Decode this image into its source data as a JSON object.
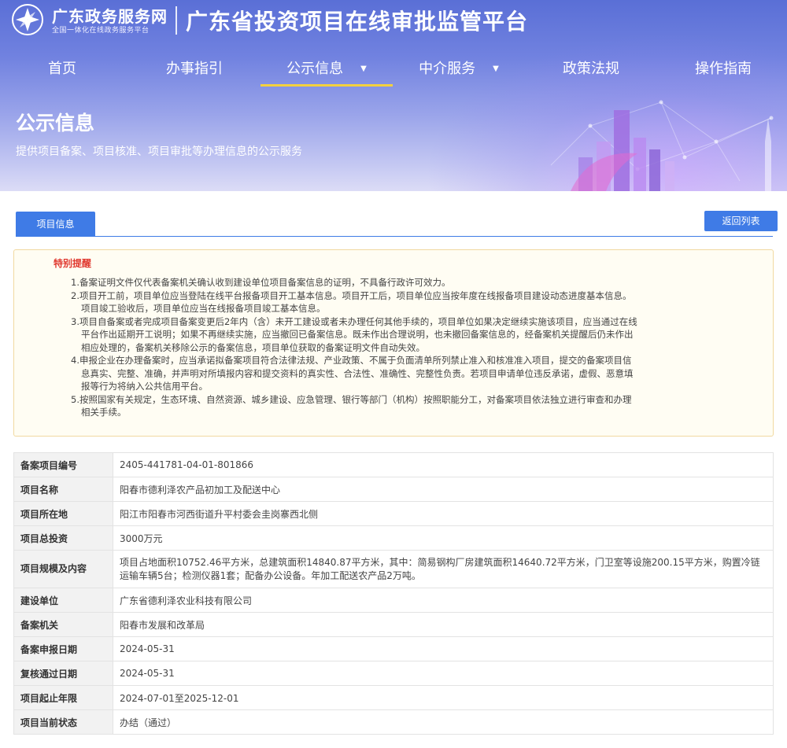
{
  "header": {
    "site_name": "广东政务服务网",
    "site_tagline": "全国一体化在线政务服务平台",
    "platform_title": "广东省投资项目在线审批监管平台"
  },
  "nav": {
    "items": [
      {
        "label": "首页",
        "has_dropdown": false,
        "active": false
      },
      {
        "label": "办事指引",
        "has_dropdown": false,
        "active": false
      },
      {
        "label": "公示信息",
        "has_dropdown": true,
        "active": true
      },
      {
        "label": "中介服务",
        "has_dropdown": true,
        "active": false
      },
      {
        "label": "政策法规",
        "has_dropdown": false,
        "active": false
      },
      {
        "label": "操作指南",
        "has_dropdown": false,
        "active": false
      }
    ]
  },
  "hero": {
    "title": "公示信息",
    "subtitle": "提供项目备案、项目核准、项目审批等办理信息的公示服务"
  },
  "tabs": {
    "active_label": "项目信息",
    "back_label": "返回列表"
  },
  "notice": {
    "title": "特别提醒",
    "lines": [
      {
        "text": "1.备案证明文件仅代表备案机关确认收到建设单位项目备案信息的证明，不具备行政许可效力。",
        "indent": false
      },
      {
        "text": "2.项目开工前，项目单位应当登陆在线平台报备项目开工基本信息。项目开工后，项目单位应当按年度在线报备项目建设动态进度基本信息。",
        "indent": false
      },
      {
        "text": "项目竣工验收后，项目单位应当在线报备项目竣工基本信息。",
        "indent": true
      },
      {
        "text": "3.项目自备案或者完成项目备案变更后2年内（含）未开工建设或者未办理任何其他手续的，项目单位如果决定继续实施该项目，应当通过在线",
        "indent": false
      },
      {
        "text": "平台作出延期开工说明；如果不再继续实施，应当撤回已备案信息。既未作出合理说明，也未撤回备案信息的，经备案机关提醒后仍未作出",
        "indent": true
      },
      {
        "text": "相应处理的，备案机关移除公示的备案信息，项目单位获取的备案证明文件自动失效。",
        "indent": true
      },
      {
        "text": "4.申报企业在办理备案时，应当承诺拟备案项目符合法律法规、产业政策、不属于负面清单所列禁止准入和核准准入项目，提交的备案项目信",
        "indent": false
      },
      {
        "text": "息真实、完整、准确，并声明对所填报内容和提交资料的真实性、合法性、准确性、完整性负责。若项目申请单位违反承诺，虚假、恶意填",
        "indent": true
      },
      {
        "text": "报等行为将纳入公共信用平台。",
        "indent": true
      },
      {
        "text": "5.按照国家有关规定，生态环境、自然资源、城乡建设、应急管理、银行等部门（机构）按照职能分工，对备案项目依法独立进行审查和办理",
        "indent": false
      },
      {
        "text": "相关手续。",
        "indent": true
      }
    ]
  },
  "project": {
    "rows": [
      {
        "key": "备案项目编号",
        "value": "2405-441781-04-01-801866"
      },
      {
        "key": "项目名称",
        "value": "阳春市德利泽农产品初加工及配送中心"
      },
      {
        "key": "项目所在地",
        "value": "阳江市阳春市河西街道升平村委会圭岗寨西北侧"
      },
      {
        "key": "项目总投资",
        "value": "3000万元"
      },
      {
        "key": "项目规模及内容",
        "value": "项目占地面积10752.46平方米，总建筑面积14840.87平方米，其中：简易钢构厂房建筑面积14640.72平方米，门卫室等设施200.15平方米，购置冷链运输车辆5台；检测仪器1套；配备办公设备。年加工配送农产品2万吨。"
      },
      {
        "key": "建设单位",
        "value": "广东省德利泽农业科技有限公司"
      },
      {
        "key": "备案机关",
        "value": "阳春市发展和改革局"
      },
      {
        "key": "备案申报日期",
        "value": "2024-05-31"
      },
      {
        "key": "复核通过日期",
        "value": "2024-05-31"
      },
      {
        "key": "项目起止年限",
        "value": "2024-07-01至2025-12-01"
      },
      {
        "key": "项目当前状态",
        "value": "办结（通过）"
      }
    ]
  },
  "colors": {
    "primary": "#3f7be6",
    "notice_title": "#e0382e",
    "nav_active_underline": "#f3d03f"
  }
}
